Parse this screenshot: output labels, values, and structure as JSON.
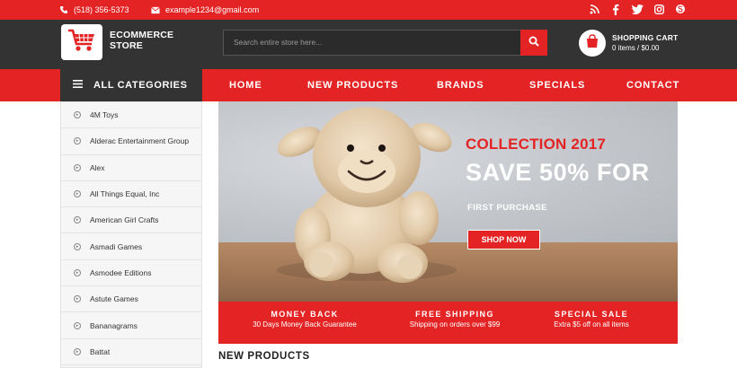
{
  "topbar": {
    "phone": "(518) 356-5373",
    "email": "example1234@gmail.com",
    "social": [
      "rss-icon",
      "facebook-icon",
      "twitter-icon",
      "instagram-icon",
      "skype-icon"
    ]
  },
  "header": {
    "brand_line1": "ECOMMERCE",
    "brand_line2": "STORE",
    "search_placeholder": "Search entire store here...",
    "cart_title": "SHOPPING CART",
    "cart_summary": "0 items / $0.00"
  },
  "nav": {
    "all_categories": "ALL CATEGORIES",
    "items": [
      "HOME",
      "NEW PRODUCTS",
      "BRANDS",
      "SPECIALS",
      "CONTACT"
    ]
  },
  "sidebar": {
    "items": [
      "4M Toys",
      "Alderac Entertainment Group",
      "Alex",
      "All Things Equal, Inc",
      "American Girl Crafts",
      "Asmadi Games",
      "Asmodee Editions",
      "Astute Games",
      "Bananagrams",
      "Battat"
    ]
  },
  "banner": {
    "title": "COLLECTION 2017",
    "headline": "SAVE 50% FOR",
    "subline": "FIRST PURCHASE",
    "button": "SHOP NOW"
  },
  "features": [
    {
      "title": "MONEY BACK",
      "desc": "30 Days Money Back Guarantee"
    },
    {
      "title": "FREE SHIPPING",
      "desc": "Shipping on orders over $99"
    },
    {
      "title": "SPECIAL SALE",
      "desc": "Extra $5 off on all items"
    }
  ],
  "section": {
    "new_products": "NEW PRODUCTS"
  },
  "colors": {
    "accent": "#e42424",
    "dark": "#333333"
  }
}
